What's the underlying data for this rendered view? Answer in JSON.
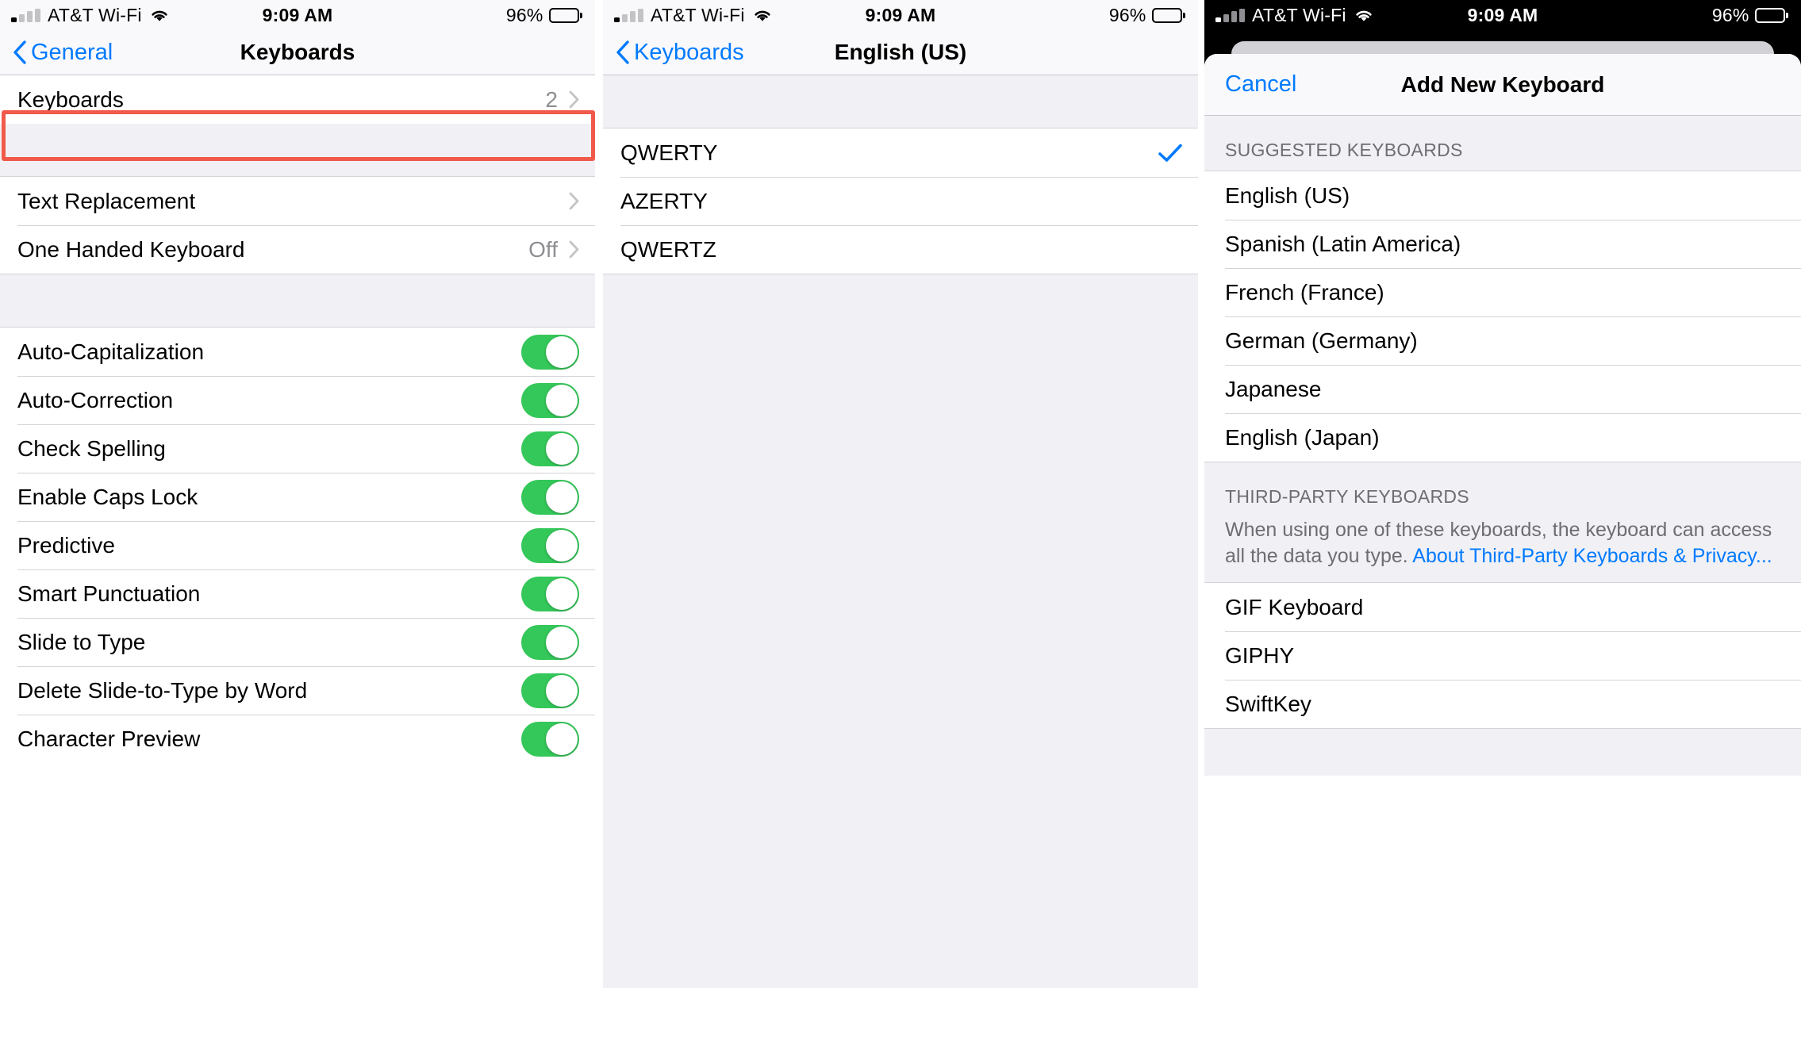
{
  "status_bar": {
    "carrier": "AT&T Wi-Fi",
    "time": "9:09 AM",
    "battery_percent": "96%",
    "signal_icon": "cellular-signal-icon",
    "wifi_icon": "wifi-icon",
    "battery_icon": "battery-icon"
  },
  "panel1": {
    "nav": {
      "back_label": "General",
      "title": "Keyboards",
      "back_icon": "chevron-left-icon"
    },
    "group1": [
      {
        "label": "Keyboards",
        "value": "2",
        "accessory": "chevron-right-icon",
        "highlighted": true
      }
    ],
    "group2": [
      {
        "label": "Text Replacement",
        "value": "",
        "accessory": "chevron-right-icon"
      },
      {
        "label": "One Handed Keyboard",
        "value": "Off",
        "accessory": "chevron-right-icon"
      }
    ],
    "group3": [
      {
        "label": "Auto-Capitalization",
        "toggle": true
      },
      {
        "label": "Auto-Correction",
        "toggle": true
      },
      {
        "label": "Check Spelling",
        "toggle": true
      },
      {
        "label": "Enable Caps Lock",
        "toggle": true
      },
      {
        "label": "Predictive",
        "toggle": true
      },
      {
        "label": "Smart Punctuation",
        "toggle": true
      },
      {
        "label": "Slide to Type",
        "toggle": true
      },
      {
        "label": "Delete Slide-to-Type by Word",
        "toggle": true
      },
      {
        "label": "Character Preview",
        "toggle": true
      }
    ],
    "highlight_color": "#f15a4a"
  },
  "panel2": {
    "nav": {
      "back_label": "Keyboards",
      "title": "English (US)",
      "back_icon": "chevron-left-icon"
    },
    "layouts": [
      {
        "label": "QWERTY",
        "selected": true,
        "accessory": "checkmark-icon"
      },
      {
        "label": "AZERTY",
        "selected": false
      },
      {
        "label": "QWERTZ",
        "selected": false
      }
    ]
  },
  "panel3": {
    "sheet": {
      "cancel_label": "Cancel",
      "title": "Add New Keyboard"
    },
    "suggested": {
      "header": "SUGGESTED KEYBOARDS",
      "items": [
        {
          "label": "English (US)"
        },
        {
          "label": "Spanish (Latin America)"
        },
        {
          "label": "French (France)"
        },
        {
          "label": "German (Germany)"
        },
        {
          "label": "Japanese"
        },
        {
          "label": "English (Japan)"
        }
      ]
    },
    "third_party": {
      "header": "THIRD-PARTY KEYBOARDS",
      "description": "When using one of these keyboards, the keyboard can access all the data you type. ",
      "link_text": "About Third-Party Keyboards & Privacy...",
      "items": [
        {
          "label": "GIF Keyboard"
        },
        {
          "label": "GIPHY"
        },
        {
          "label": "SwiftKey"
        }
      ]
    }
  },
  "colors": {
    "accent_blue": "#007aff",
    "toggle_green": "#34c759",
    "highlight_red": "#f15a4a",
    "group_bg": "#f1f1f5"
  }
}
